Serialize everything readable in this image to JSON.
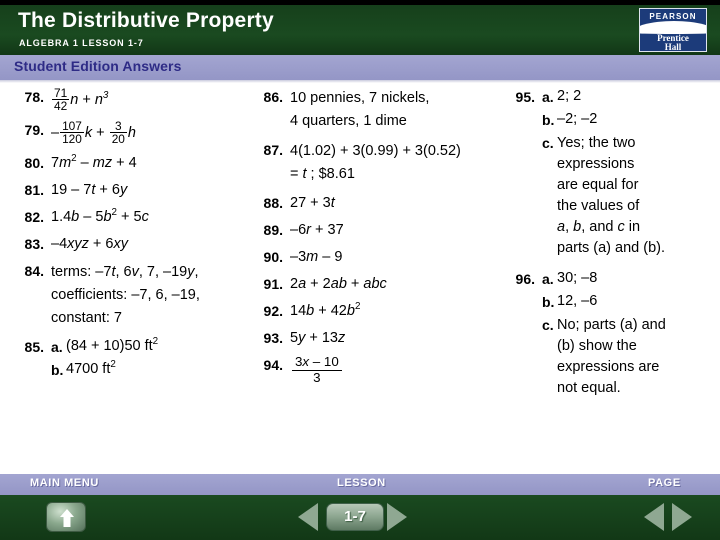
{
  "header": {
    "title": "The Distributive Property",
    "subtitle": "ALGEBRA 1  LESSON 1-7",
    "logo": {
      "brand": "PEARSON",
      "line1": "Prentice",
      "line2": "Hall",
      "bg_color": "#1c3b7a"
    },
    "bg_color": "#16401b"
  },
  "band": {
    "label": "Student Edition Answers",
    "bg_color": "#9a9ccb",
    "text_color": "#2e2b86"
  },
  "answers": {
    "left": [
      {
        "num": "78.",
        "lines": [
          "frac_71_42_n_n3"
        ]
      },
      {
        "num": "79.",
        "lines": [
          "frac_107_120_k_3_20_h"
        ]
      },
      {
        "num": "80.",
        "lines": [
          "7m2_mz_4"
        ]
      },
      {
        "num": "81.",
        "lines": [
          "19 – 7t + 6y"
        ]
      },
      {
        "num": "82.",
        "lines": [
          "1.4b – 5b2 + 5c"
        ]
      },
      {
        "num": "83.",
        "lines": [
          "–4xyz + 6xy"
        ]
      },
      {
        "num": "84.",
        "lines": [
          "terms: –7t, 6v, 7, –19y,",
          "coefficients: –7, 6, –19,",
          "constant: 7"
        ]
      },
      {
        "num": "85.",
        "parts": [
          {
            "letter": "a.",
            "text": "(84 + 10)50 ft2"
          },
          {
            "letter": "b.",
            "text": "4700 ft2"
          }
        ]
      }
    ],
    "left_text": {
      "n78_num": "71",
      "n78_den": "42",
      "n78_rest_var": "n",
      "n78_plus": " + ",
      "n78_term2": "n",
      "n78_term2_sup": "3",
      "n79_minus": "–",
      "n79_num1": "107",
      "n79_den1": "120",
      "n79_var1": "k",
      "n79_plus": " + ",
      "n79_num2": "3",
      "n79_den2": "20",
      "n79_var2": "h",
      "n80_a": "7",
      "n80_m": "m",
      "n80_sup": "2",
      "n80_b": " – ",
      "n80_mz": "mz",
      "n80_c": " + 4",
      "n81": "19 – 7",
      "n81_t": "t",
      "n81_b": " + 6",
      "n81_y": "y",
      "n82_a": "1.4",
      "n82_b1": "b",
      "n82_b": " – 5",
      "n82_b2": "b",
      "n82_sup": "2",
      "n82_c": " + 5",
      "n82_c1": "c",
      "n83_a": "–4",
      "n83_xyz": "xyz",
      "n83_b": " + 6",
      "n83_xy": "xy",
      "n84_l1_pre": "terms: –7",
      "n84_l1_t": "t",
      "n84_l1_mid": ", 6",
      "n84_l1_v": "v",
      "n84_l1_post": ", 7, –19",
      "n84_l1_y": "y",
      "n84_l1_end": ",",
      "n84_l2": "coefficients: –7, 6, –19,",
      "n84_l3": "constant: 7",
      "n85_a": "(84 + 10)50 ft",
      "n85_a_sup": "2",
      "n85_b": "4700 ft",
      "n85_b_sup": "2"
    },
    "mid_text": {
      "n86_l1": "10 pennies, 7 nickels,",
      "n86_l2": "4 quarters, 1 dime",
      "n87_l1": "4(1.02) + 3(0.99) + 3(0.52)",
      "n87_l2_eq": "= ",
      "n87_l2_t": "t",
      "n87_l2_rest": " ; $8.61",
      "n88_a": "27 + 3",
      "n88_t": "t",
      "n89_a": "–6",
      "n89_r": "r",
      "n89_b": " + 37",
      "n90_a": "–3",
      "n90_m": "m",
      "n90_b": " – 9",
      "n91_a": "2",
      "n91_v1": "a",
      "n91_b": " + 2",
      "n91_v2": "ab",
      "n91_c": " + ",
      "n91_v3": "abc",
      "n92_a": "14",
      "n92_b1": "b",
      "n92_b": " + 42",
      "n92_b2": "b",
      "n92_sup": "2",
      "n93_a": "5",
      "n93_y": "y",
      "n93_b": " + 13",
      "n93_z": "z",
      "n94_num_a": "3",
      "n94_num_x": "x",
      "n94_num_b": " – 10",
      "n94_den": "3"
    },
    "mid_nums": [
      "86.",
      "87.",
      "88.",
      "89.",
      "90.",
      "91.",
      "92.",
      "93.",
      "94."
    ],
    "right": {
      "n95": "95.",
      "n95a_let": "a.",
      "n95a": "2; 2",
      "n95b_let": "b.",
      "n95b": "–2; –2",
      "n95c_let": "c.",
      "n95c_l1": "Yes; the two",
      "n95c_l2": "expressions",
      "n95c_l3": "are equal for",
      "n95c_l4": "the values of",
      "n95c_l5_a": "a",
      "n95c_l5_b": ", ",
      "n95c_l5_c": "b",
      "n95c_l5_d": ", and ",
      "n95c_l5_e": "c",
      "n95c_l5_f": " in",
      "n95c_l6": "parts (a) and (b).",
      "n96": "96.",
      "n96a_let": "a.",
      "n96a": "30; –8",
      "n96b_let": "b.",
      "n96b": "12, –6",
      "n96c_let": "c.",
      "n96c_l1": "No; parts (a) and",
      "n96c_l2": "(b) show the",
      "n96c_l3": "expressions are",
      "n96c_l4": "not equal."
    }
  },
  "footer": {
    "main_menu_label": "MAIN MENU",
    "lesson_label": "LESSON",
    "page_label": "PAGE",
    "lesson_number": "1-7",
    "band_color": "#9a9ccb",
    "bar_color": "#16401b"
  }
}
